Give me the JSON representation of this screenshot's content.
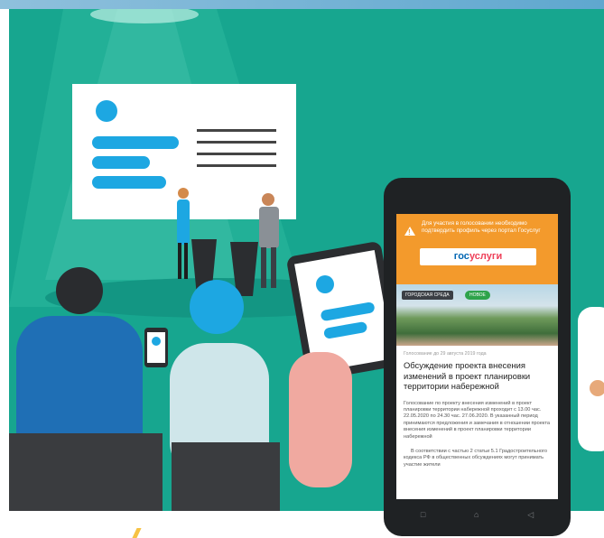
{
  "phone": {
    "notice_text": "Для участия в голосовании необходимо подтвердить профиль через портал Госуслуг",
    "gosuslugi_part1": "гос",
    "gosuslugi_part2": "услуги",
    "tag_category": "ГОРОДСКАЯ СРЕДА",
    "tag_new": "НОВОЕ",
    "date": "Голосование до 29 августа 2019 года",
    "title": "Обсуждение проекта внесения изменений в проект планировки территории набережной",
    "body_paragraph_1": "Голосование по проекту внесения изменений в проект планировки территории набережной проходит с 13.00 час. 22.05.2020 по 24.30 час. 27.06.2020. В указанный период принимаются предложения и замечания в отношении проекта внесения изменений в проект планировки территории набережной",
    "body_paragraph_2": "В соответствии с частью 2 статьи 5.1 Градостроительного кодекса РФ в общественных обсуждениях могут принимать участие жители",
    "nav_icons": [
      "square-icon",
      "home-icon",
      "back-icon"
    ],
    "nav_glyphs": [
      "□",
      "⌂",
      "◁"
    ]
  },
  "colors": {
    "background_teal": "#17a68f",
    "notice_orange": "#f39a2c",
    "gos_blue": "#0066b3",
    "gos_red": "#ee3f58",
    "accent_blue": "#1da7e2"
  }
}
